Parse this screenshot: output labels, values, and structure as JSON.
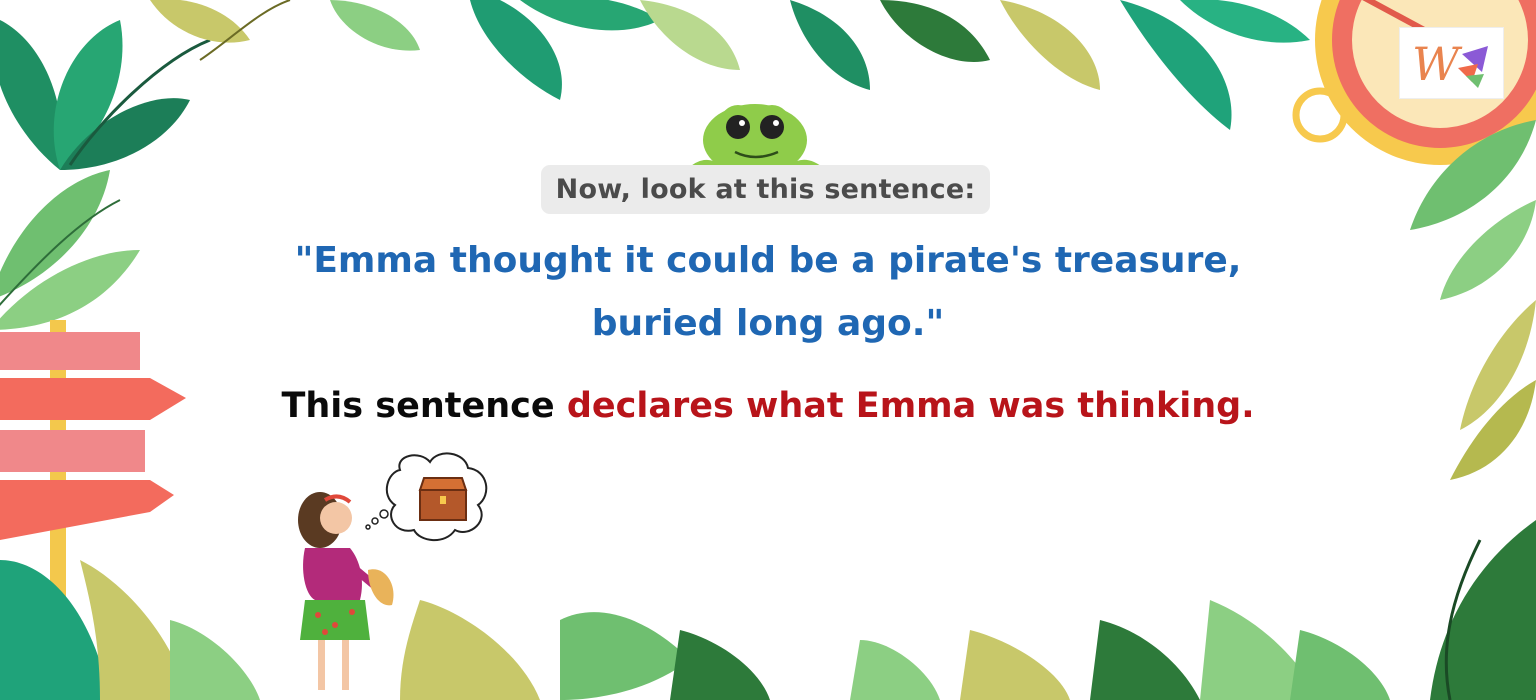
{
  "prompt": {
    "text": "Now, look at this sentence:"
  },
  "quote": {
    "line1": "\"Emma thought it could be a pirate's treasure,",
    "line2": "buried long ago.\""
  },
  "statement": {
    "lead": "This sentence ",
    "highlight": "declares what Emma was thinking."
  },
  "colors": {
    "prompt_text": "#4b4b4b",
    "prompt_bg": "#ebebeb",
    "quote": "#1f67b3",
    "statement": "#0a0a0a",
    "highlight": "#b8141a"
  },
  "icons": {
    "mascot": "frog-mascot-icon",
    "logo": "w-logo-icon",
    "girl": "girl-illustration",
    "thought": "treasure-chest-icon",
    "signpost": "signpost-icon",
    "compass": "compass-icon"
  }
}
